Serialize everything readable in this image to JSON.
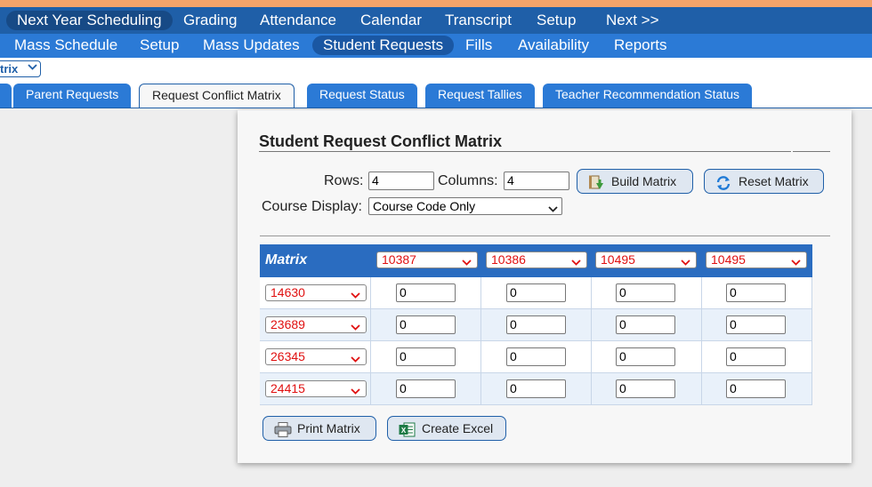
{
  "nav_primary": [
    "Next Year Scheduling",
    "Grading",
    "Attendance",
    "Calendar",
    "Transcript",
    "Setup",
    "Next >>"
  ],
  "nav_secondary": [
    "Mass Schedule",
    "Setup",
    "Mass Updates",
    "Student Requests",
    "Fills",
    "Availability",
    "Reports"
  ],
  "subbar_select": "trix",
  "tabs": [
    "Parent Requests",
    "Request Conflict Matrix",
    "Request Status",
    "Request Tallies",
    "Teacher Recommendation Status"
  ],
  "panel": {
    "title": "Student Request Conflict Matrix",
    "rows_label": "Rows:",
    "rows_value": "4",
    "columns_label": "Columns:",
    "columns_value": "4",
    "build_button": "Build Matrix",
    "reset_button": "Reset Matrix",
    "course_display_label": "Course Display:",
    "course_display_value": "Course Code Only",
    "matrix_label": "Matrix",
    "column_courses": [
      "10387",
      "10386",
      "10495",
      "10495"
    ],
    "row_courses": [
      "14630",
      "23689",
      "26345",
      "24415"
    ],
    "cells": [
      [
        "0",
        "0",
        "0",
        "0"
      ],
      [
        "0",
        "0",
        "0",
        "0"
      ],
      [
        "0",
        "0",
        "0",
        "0"
      ],
      [
        "0",
        "0",
        "0",
        "0"
      ]
    ],
    "print_button": "Print Matrix",
    "excel_button": "Create Excel"
  },
  "colors": {
    "nav_primary_bg": "#1f5fa8",
    "nav_secondary_bg": "#2b7ad6",
    "accent_orange": "#f5a46a",
    "course_code_red": "#e01010"
  },
  "icons": {
    "build": "build-matrix-icon",
    "reset": "refresh-icon",
    "print": "printer-icon",
    "excel": "excel-icon",
    "dropdown": "chevron-down-icon"
  }
}
